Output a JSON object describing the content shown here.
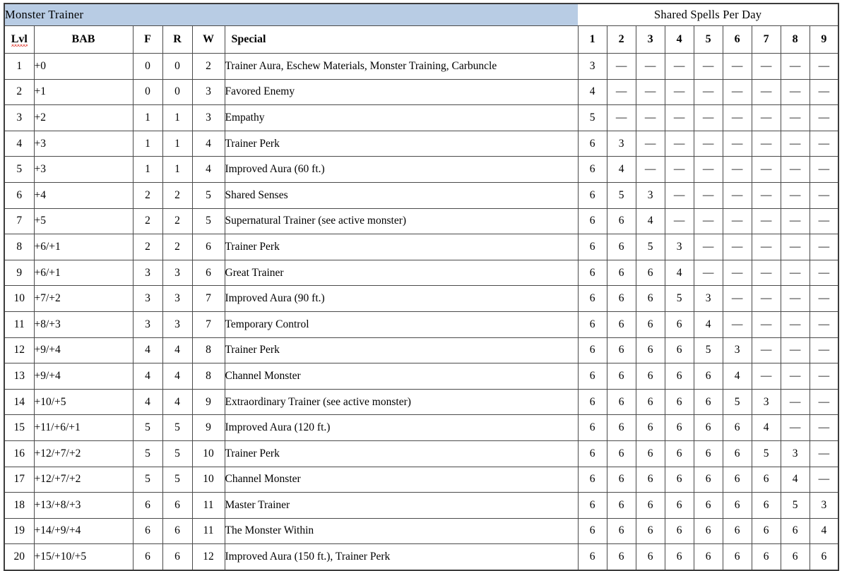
{
  "title_band": {
    "class_name": "Monster Trainer",
    "spells_header": "Shared Spells Per Day"
  },
  "columns": {
    "lvl": "Lvl",
    "bab": "BAB",
    "fort": "F",
    "ref": "R",
    "will": "W",
    "special": "Special",
    "spell_levels": [
      "1",
      "2",
      "3",
      "4",
      "5",
      "6",
      "7",
      "8",
      "9"
    ]
  },
  "colors": {
    "title_band": "#b8cce4",
    "border": "#4a4a4a",
    "outer_border": "#3c3c3c",
    "spellcheck_underline": "#e03a2f",
    "text": "#000000",
    "background": "#ffffff"
  },
  "empty_marker": "—",
  "rows": [
    {
      "lvl": "1",
      "bab": "+0",
      "fort": "0",
      "ref": "0",
      "will": "2",
      "special": "Trainer Aura, Eschew Materials, Monster Training,  Carbuncle",
      "spells": [
        "3",
        "—",
        "—",
        "—",
        "—",
        "—",
        "—",
        "—",
        "—"
      ]
    },
    {
      "lvl": "2",
      "bab": "+1",
      "fort": "0",
      "ref": "0",
      "will": "3",
      "special": "Favored Enemy",
      "spells": [
        "4",
        "—",
        "—",
        "—",
        "—",
        "—",
        "—",
        "—",
        "—"
      ]
    },
    {
      "lvl": "3",
      "bab": "+2",
      "fort": "1",
      "ref": "1",
      "will": "3",
      "special": "Empathy",
      "spells": [
        "5",
        "—",
        "—",
        "—",
        "—",
        "—",
        "—",
        "—",
        "—"
      ]
    },
    {
      "lvl": "4",
      "bab": "+3",
      "fort": "1",
      "ref": "1",
      "will": "4",
      "special": "Trainer Perk",
      "spells": [
        "6",
        "3",
        "—",
        "—",
        "—",
        "—",
        "—",
        "—",
        "—"
      ]
    },
    {
      "lvl": "5",
      "bab": "+3",
      "fort": "1",
      "ref": "1",
      "will": "4",
      "special": "Improved Aura (60 ft.)",
      "spells": [
        "6",
        "4",
        "—",
        "—",
        "—",
        "—",
        "—",
        "—",
        "—"
      ]
    },
    {
      "lvl": "6",
      "bab": "+4",
      "fort": "2",
      "ref": "2",
      "will": "5",
      "special": "Shared Senses",
      "spells": [
        "6",
        "5",
        "3",
        "—",
        "—",
        "—",
        "—",
        "—",
        "—"
      ]
    },
    {
      "lvl": "7",
      "bab": "+5",
      "fort": "2",
      "ref": "2",
      "will": "5",
      "special": "Supernatural Trainer (see active monster)",
      "spells": [
        "6",
        "6",
        "4",
        "—",
        "—",
        "—",
        "—",
        "—",
        "—"
      ]
    },
    {
      "lvl": "8",
      "bab": "+6/+1",
      "fort": "2",
      "ref": "2",
      "will": "6",
      "special": "Trainer Perk",
      "spells": [
        "6",
        "6",
        "5",
        "3",
        "—",
        "—",
        "—",
        "—",
        "—"
      ]
    },
    {
      "lvl": "9",
      "bab": "+6/+1",
      "fort": "3",
      "ref": "3",
      "will": "6",
      "special": "Great Trainer",
      "spells": [
        "6",
        "6",
        "6",
        "4",
        "—",
        "—",
        "—",
        "—",
        "—"
      ]
    },
    {
      "lvl": "10",
      "bab": "+7/+2",
      "fort": "3",
      "ref": "3",
      "will": "7",
      "special": "Improved Aura (90 ft.)",
      "spells": [
        "6",
        "6",
        "6",
        "5",
        "3",
        "—",
        "—",
        "—",
        "—"
      ]
    },
    {
      "lvl": "11",
      "bab": "+8/+3",
      "fort": "3",
      "ref": "3",
      "will": "7",
      "special": "Temporary Control",
      "spells": [
        "6",
        "6",
        "6",
        "6",
        "4",
        "—",
        "—",
        "—",
        "—"
      ]
    },
    {
      "lvl": "12",
      "bab": "+9/+4",
      "fort": "4",
      "ref": "4",
      "will": "8",
      "special": "Trainer Perk",
      "spells": [
        "6",
        "6",
        "6",
        "6",
        "5",
        "3",
        "—",
        "—",
        "—"
      ]
    },
    {
      "lvl": "13",
      "bab": "+9/+4",
      "fort": "4",
      "ref": "4",
      "will": "8",
      "special": "Channel Monster",
      "spells": [
        "6",
        "6",
        "6",
        "6",
        "6",
        "4",
        "—",
        "—",
        "—"
      ]
    },
    {
      "lvl": "14",
      "bab": "+10/+5",
      "fort": "4",
      "ref": "4",
      "will": "9",
      "special": "Extraordinary  Trainer (see active monster)",
      "spells": [
        "6",
        "6",
        "6",
        "6",
        "6",
        "5",
        "3",
        "—",
        "—"
      ]
    },
    {
      "lvl": "15",
      "bab": "+11/+6/+1",
      "fort": "5",
      "ref": "5",
      "will": "9",
      "special": "Improved Aura (120 ft.)",
      "spells": [
        "6",
        "6",
        "6",
        "6",
        "6",
        "6",
        "4",
        "—",
        "—"
      ]
    },
    {
      "lvl": "16",
      "bab": "+12/+7/+2",
      "fort": "5",
      "ref": "5",
      "will": "10",
      "special": "Trainer Perk",
      "spells": [
        "6",
        "6",
        "6",
        "6",
        "6",
        "6",
        "5",
        "3",
        "—"
      ]
    },
    {
      "lvl": "17",
      "bab": "+12/+7/+2",
      "fort": "5",
      "ref": "5",
      "will": "10",
      "special": "Channel Monster",
      "spells": [
        "6",
        "6",
        "6",
        "6",
        "6",
        "6",
        "6",
        "4",
        "—"
      ]
    },
    {
      "lvl": "18",
      "bab": "+13/+8/+3",
      "fort": "6",
      "ref": "6",
      "will": "11",
      "special": "Master Trainer",
      "spells": [
        "6",
        "6",
        "6",
        "6",
        "6",
        "6",
        "6",
        "5",
        "3"
      ]
    },
    {
      "lvl": "19",
      "bab": "+14/+9/+4",
      "fort": "6",
      "ref": "6",
      "will": "11",
      "special": "The Monster Within",
      "spells": [
        "6",
        "6",
        "6",
        "6",
        "6",
        "6",
        "6",
        "6",
        "4"
      ]
    },
    {
      "lvl": "20",
      "bab": "+15/+10/+5",
      "fort": "6",
      "ref": "6",
      "will": "12",
      "special": "Improved Aura (150 ft.), Trainer Perk",
      "spells": [
        "6",
        "6",
        "6",
        "6",
        "6",
        "6",
        "6",
        "6",
        "6"
      ]
    }
  ]
}
